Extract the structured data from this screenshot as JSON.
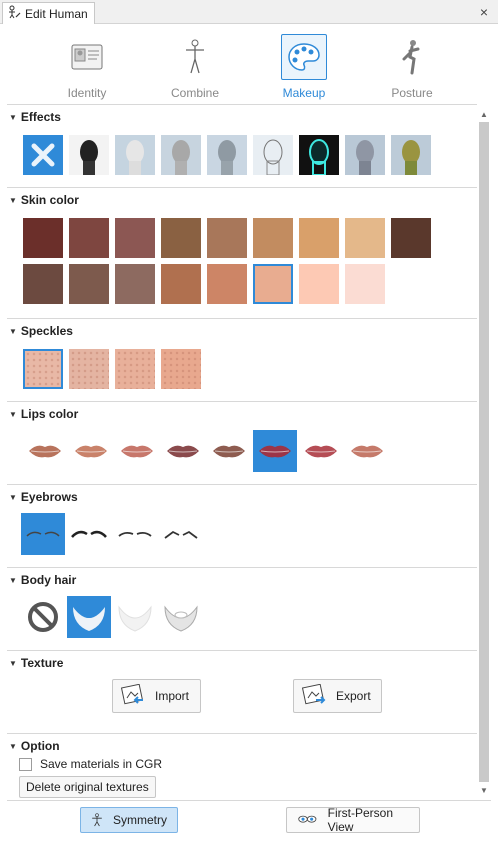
{
  "window": {
    "title": "Edit Human",
    "close_glyph": "×"
  },
  "tabs": [
    {
      "label": "Identity",
      "icon": "id-card-icon",
      "active": false
    },
    {
      "label": "Combine",
      "icon": "human-figure-icon",
      "active": false
    },
    {
      "label": "Makeup",
      "icon": "palette-icon",
      "active": true
    },
    {
      "label": "Posture",
      "icon": "posture-figure-icon",
      "active": false
    }
  ],
  "sections": {
    "effects": {
      "title": "Effects"
    },
    "skin_color": {
      "title": "Skin color"
    },
    "speckles": {
      "title": "Speckles"
    },
    "lips_color": {
      "title": "Lips color"
    },
    "eyebrows": {
      "title": "Eyebrows"
    },
    "body_hair": {
      "title": "Body hair"
    },
    "texture": {
      "title": "Texture",
      "import_label": "Import",
      "export_label": "Export"
    },
    "option": {
      "title": "Option",
      "save_materials_label": "Save materials in CGR",
      "save_materials_checked": false,
      "delete_textures_label": "Delete original textures"
    }
  },
  "skin_colors": [
    "#6b2f2a",
    "#7e4640",
    "#8c5753",
    "#8a6142",
    "#a8775a",
    "#c28c60",
    "#d9a06a",
    "#e4b88a",
    "#5a382c",
    "#6c4a40",
    "#7d5a4d",
    "#8d6a60",
    "#b0704f",
    "#cd8566",
    "#e8ac90",
    "#fdc9b4",
    "#fbdcd3"
  ],
  "skin_selected_index": 14,
  "lip_colors": [
    "#b8735c",
    "#c9826a",
    "#c7776b",
    "#8a4a4c",
    "#8e5c50",
    "#9b3548",
    "#b54d55",
    "#c57a6a"
  ],
  "lip_selected_index": 5,
  "speckle_colors": [
    "#e8b8a6",
    "#e4b4a2",
    "#e8b09a",
    "#e8a88e"
  ],
  "speckle_selected_index": 0,
  "accent_color": "#2f8ad8",
  "bottom": {
    "symmetry_label": "Symmetry",
    "symmetry_active": true,
    "first_person_label": "First-Person View"
  }
}
